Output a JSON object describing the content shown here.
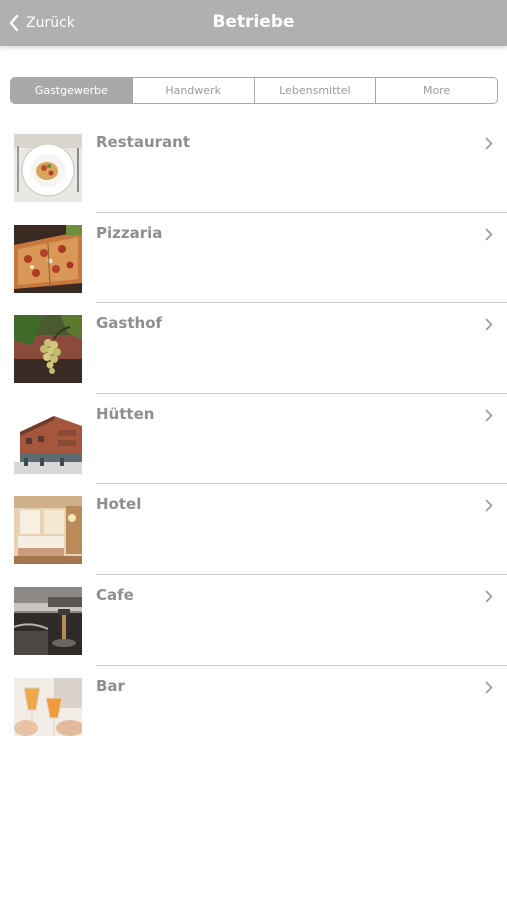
{
  "nav": {
    "back_label": "Zurück",
    "title": "Betriebe",
    "back_icon": "chevron-left-icon",
    "background": "#b0b0b0"
  },
  "tabs": [
    {
      "label": "Gastgewerbe",
      "selected": true
    },
    {
      "label": "Handwerk",
      "selected": false
    },
    {
      "label": "Lebensmittel",
      "selected": false
    },
    {
      "label": "More",
      "selected": false
    }
  ],
  "items": [
    {
      "label": "Restaurant",
      "image": "pasta-plate-photo"
    },
    {
      "label": "Pizzaria",
      "image": "pizza-photo"
    },
    {
      "label": "Gasthof",
      "image": "grapes-vine-photo"
    },
    {
      "label": "Hütten",
      "image": "hut-building-photo"
    },
    {
      "label": "Hotel",
      "image": "hotel-room-photo"
    },
    {
      "label": "Cafe",
      "image": "espresso-machine-photo"
    },
    {
      "label": "Bar",
      "image": "drinks-toast-photo"
    }
  ],
  "row_chevron_icon": "chevron-right-icon"
}
